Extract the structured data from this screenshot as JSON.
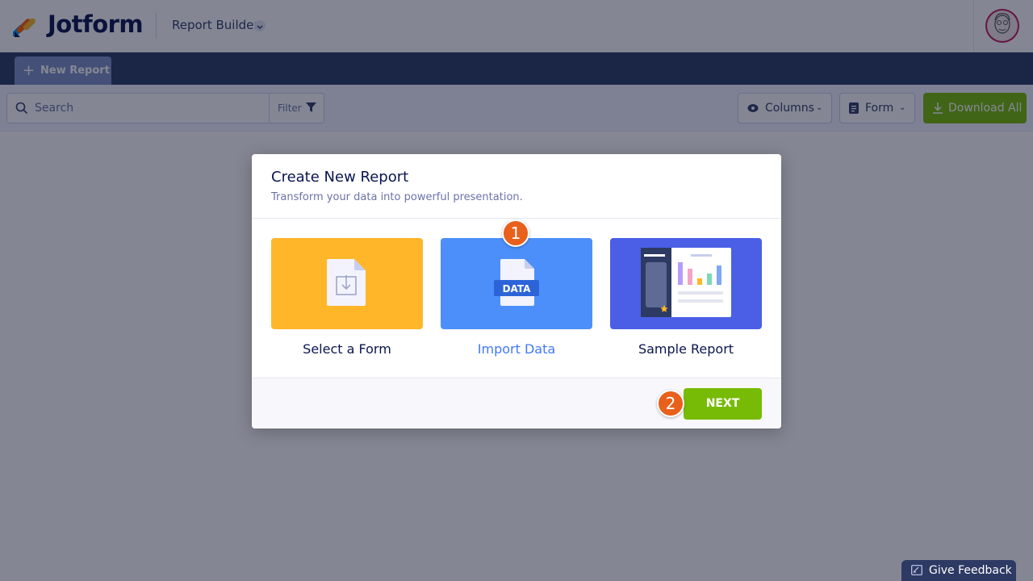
{
  "header": {
    "brand": "Jotform",
    "app_title": "Report Builder"
  },
  "tabs": [
    {
      "label": "New Report"
    }
  ],
  "toolbar": {
    "search_placeholder": "Search",
    "filter_label": "Filter",
    "columns_label": "Columns",
    "form_label": "Form",
    "download_label": "Download All"
  },
  "modal": {
    "title": "Create New Report",
    "subtitle": "Transform your data into powerful presentation.",
    "options": [
      {
        "label": "Select a Form",
        "color": "#ffb629"
      },
      {
        "label": "Import Data",
        "color": "#4c8ffb",
        "badge": "DATA"
      },
      {
        "label": "Sample Report",
        "color": "#4a5fe6"
      }
    ],
    "next_label": "NEXT"
  },
  "steps": [
    "1",
    "2"
  ],
  "feedback_label": "Give Feedback",
  "colors": {
    "accent_green": "#78bb07",
    "navy": "#2d3a63",
    "step_orange": "#e8601c",
    "selected_text": "#4277ff"
  }
}
